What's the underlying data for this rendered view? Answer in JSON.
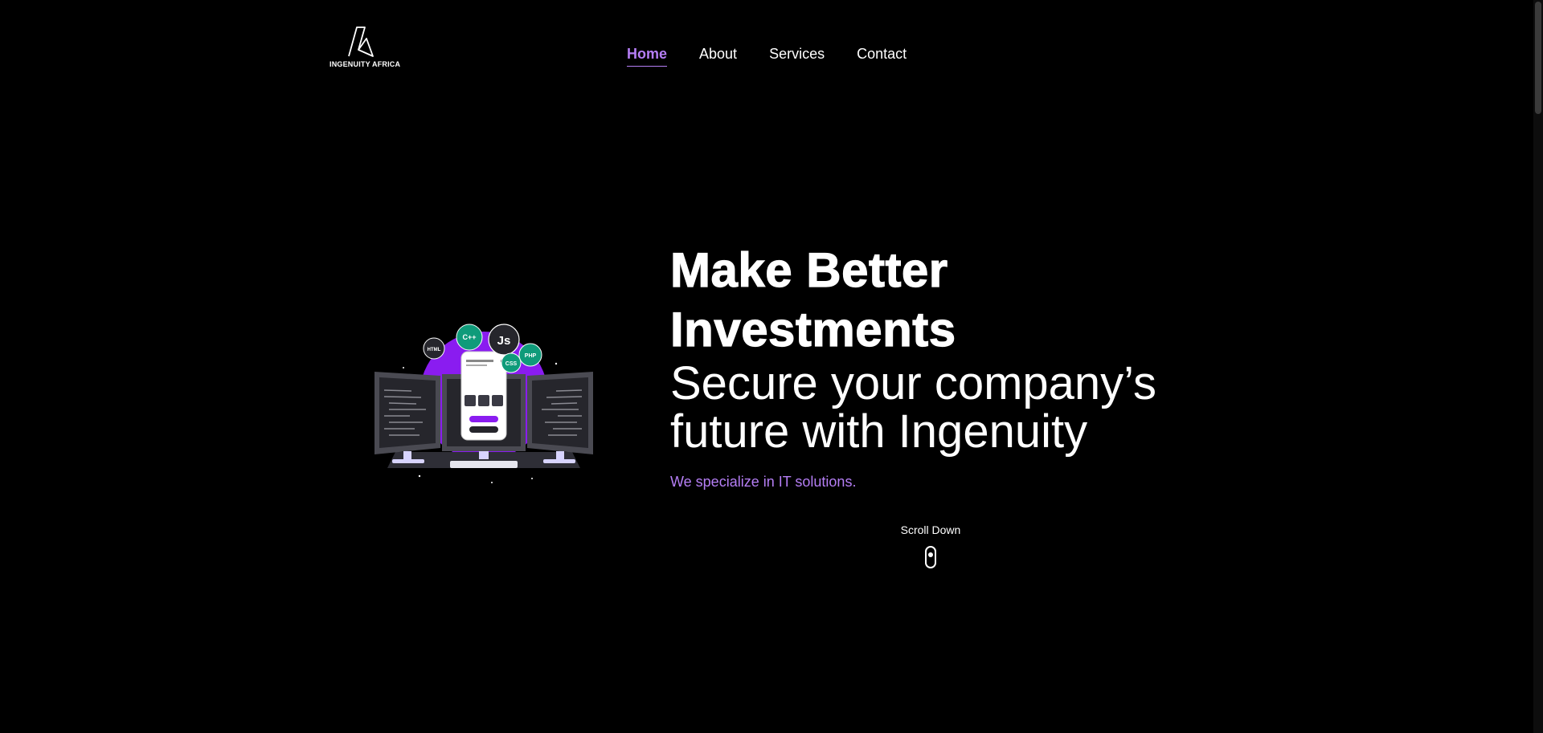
{
  "header": {
    "logo_text": "INGENUITY AFRICA",
    "nav": [
      {
        "label": "Home",
        "active": true
      },
      {
        "label": "About",
        "active": false
      },
      {
        "label": "Services",
        "active": false
      },
      {
        "label": "Contact",
        "active": false
      }
    ]
  },
  "hero": {
    "title_line1": "Make Better",
    "title_line2": "Investments",
    "subtitle_line1": "Secure your company’s",
    "subtitle_line2": "future with Ingenuity",
    "tagline": "We specialize in IT solutions.",
    "illustration": {
      "badges": [
        "HTML",
        "C++",
        "Js",
        "CSS",
        "PHP"
      ]
    }
  },
  "scroll_hint": {
    "label": "Scroll Down"
  },
  "colors": {
    "accent": "#b57ef5",
    "illustration_purple": "#8a1cf0",
    "badge_green": "#0f9b7a",
    "background": "#000000"
  }
}
